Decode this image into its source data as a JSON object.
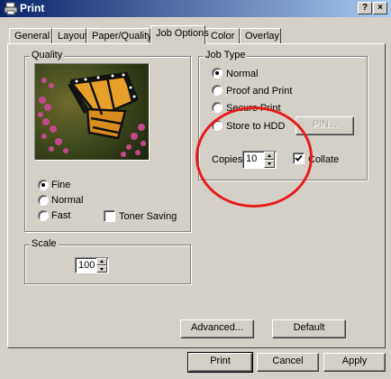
{
  "window": {
    "title": "Print",
    "help_button": "?",
    "close_button": "×"
  },
  "tabs": [
    {
      "label": "General",
      "active": false
    },
    {
      "label": "Layout",
      "active": false
    },
    {
      "label": "Paper/Quality",
      "active": false
    },
    {
      "label": "Job Options",
      "active": true
    },
    {
      "label": "Color",
      "active": false
    },
    {
      "label": "Overlay",
      "active": false
    }
  ],
  "quality": {
    "legend": "Quality",
    "options": [
      {
        "label": "Fine",
        "selected": true
      },
      {
        "label": "Normal",
        "selected": false
      },
      {
        "label": "Fast",
        "selected": false
      }
    ],
    "toner_saving": {
      "label": "Toner Saving",
      "checked": false
    }
  },
  "scale": {
    "legend": "Scale",
    "value": "100"
  },
  "job_type": {
    "legend": "Job Type",
    "options": [
      {
        "label": "Normal",
        "selected": true
      },
      {
        "label": "Proof and Print",
        "selected": false
      },
      {
        "label": "Secure Print",
        "selected": false
      },
      {
        "label": "Store to HDD",
        "selected": false
      }
    ],
    "pin_button": "PIN...",
    "copies_label": "Copies",
    "copies_value": "10",
    "collate": {
      "label": "Collate",
      "checked": true
    }
  },
  "buttons": {
    "advanced": "Advanced...",
    "default": "Default",
    "print": "Print",
    "cancel": "Cancel",
    "apply": "Apply"
  },
  "colors": {
    "title_bar_start": "#0a246a",
    "title_bar_end": "#a6caf0",
    "annotation_circle": "#e81c1c",
    "dialog_face": "#d4d0c8"
  }
}
